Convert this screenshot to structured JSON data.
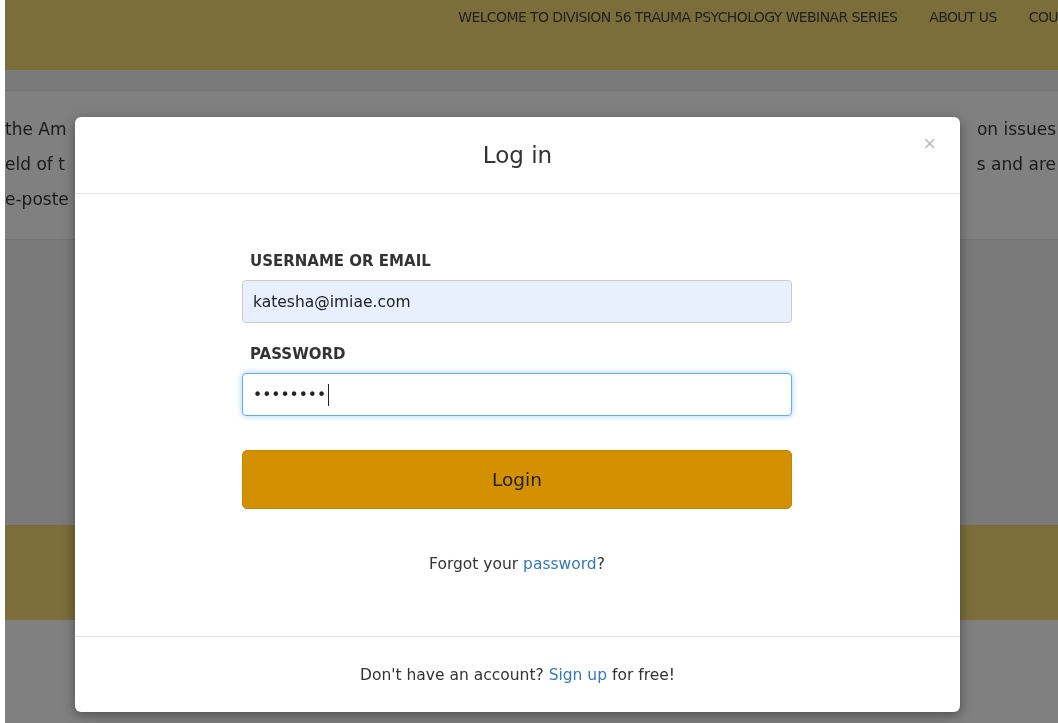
{
  "nav": {
    "items": [
      {
        "label": "WELCOME TO DIVISION 56 TRAUMA PSYCHOLOGY WEBINAR SERIES"
      },
      {
        "label": "ABOUT US"
      },
      {
        "label": "COU"
      }
    ]
  },
  "background": {
    "text_lines": [
      {
        "left": "the Am",
        "right": "on issues"
      },
      {
        "left": "eld of t",
        "right": "s and are"
      },
      {
        "left": "e-poste"
      }
    ]
  },
  "modal": {
    "title": "Log in",
    "close": "×",
    "fields": [
      {
        "label": "USERNAME OR EMAIL",
        "value": "katesha@imiae.com",
        "autofilled": true,
        "focused": false
      },
      {
        "label": "PASSWORD",
        "value": "••••••••",
        "autofilled": false,
        "focused": true
      }
    ],
    "submit": "Login",
    "forgot": {
      "before": "Forgot your ",
      "link": "password",
      "after": "?"
    },
    "footer": {
      "before": "Don't have an account? ",
      "link": "Sign up",
      "after": " for free!"
    }
  }
}
